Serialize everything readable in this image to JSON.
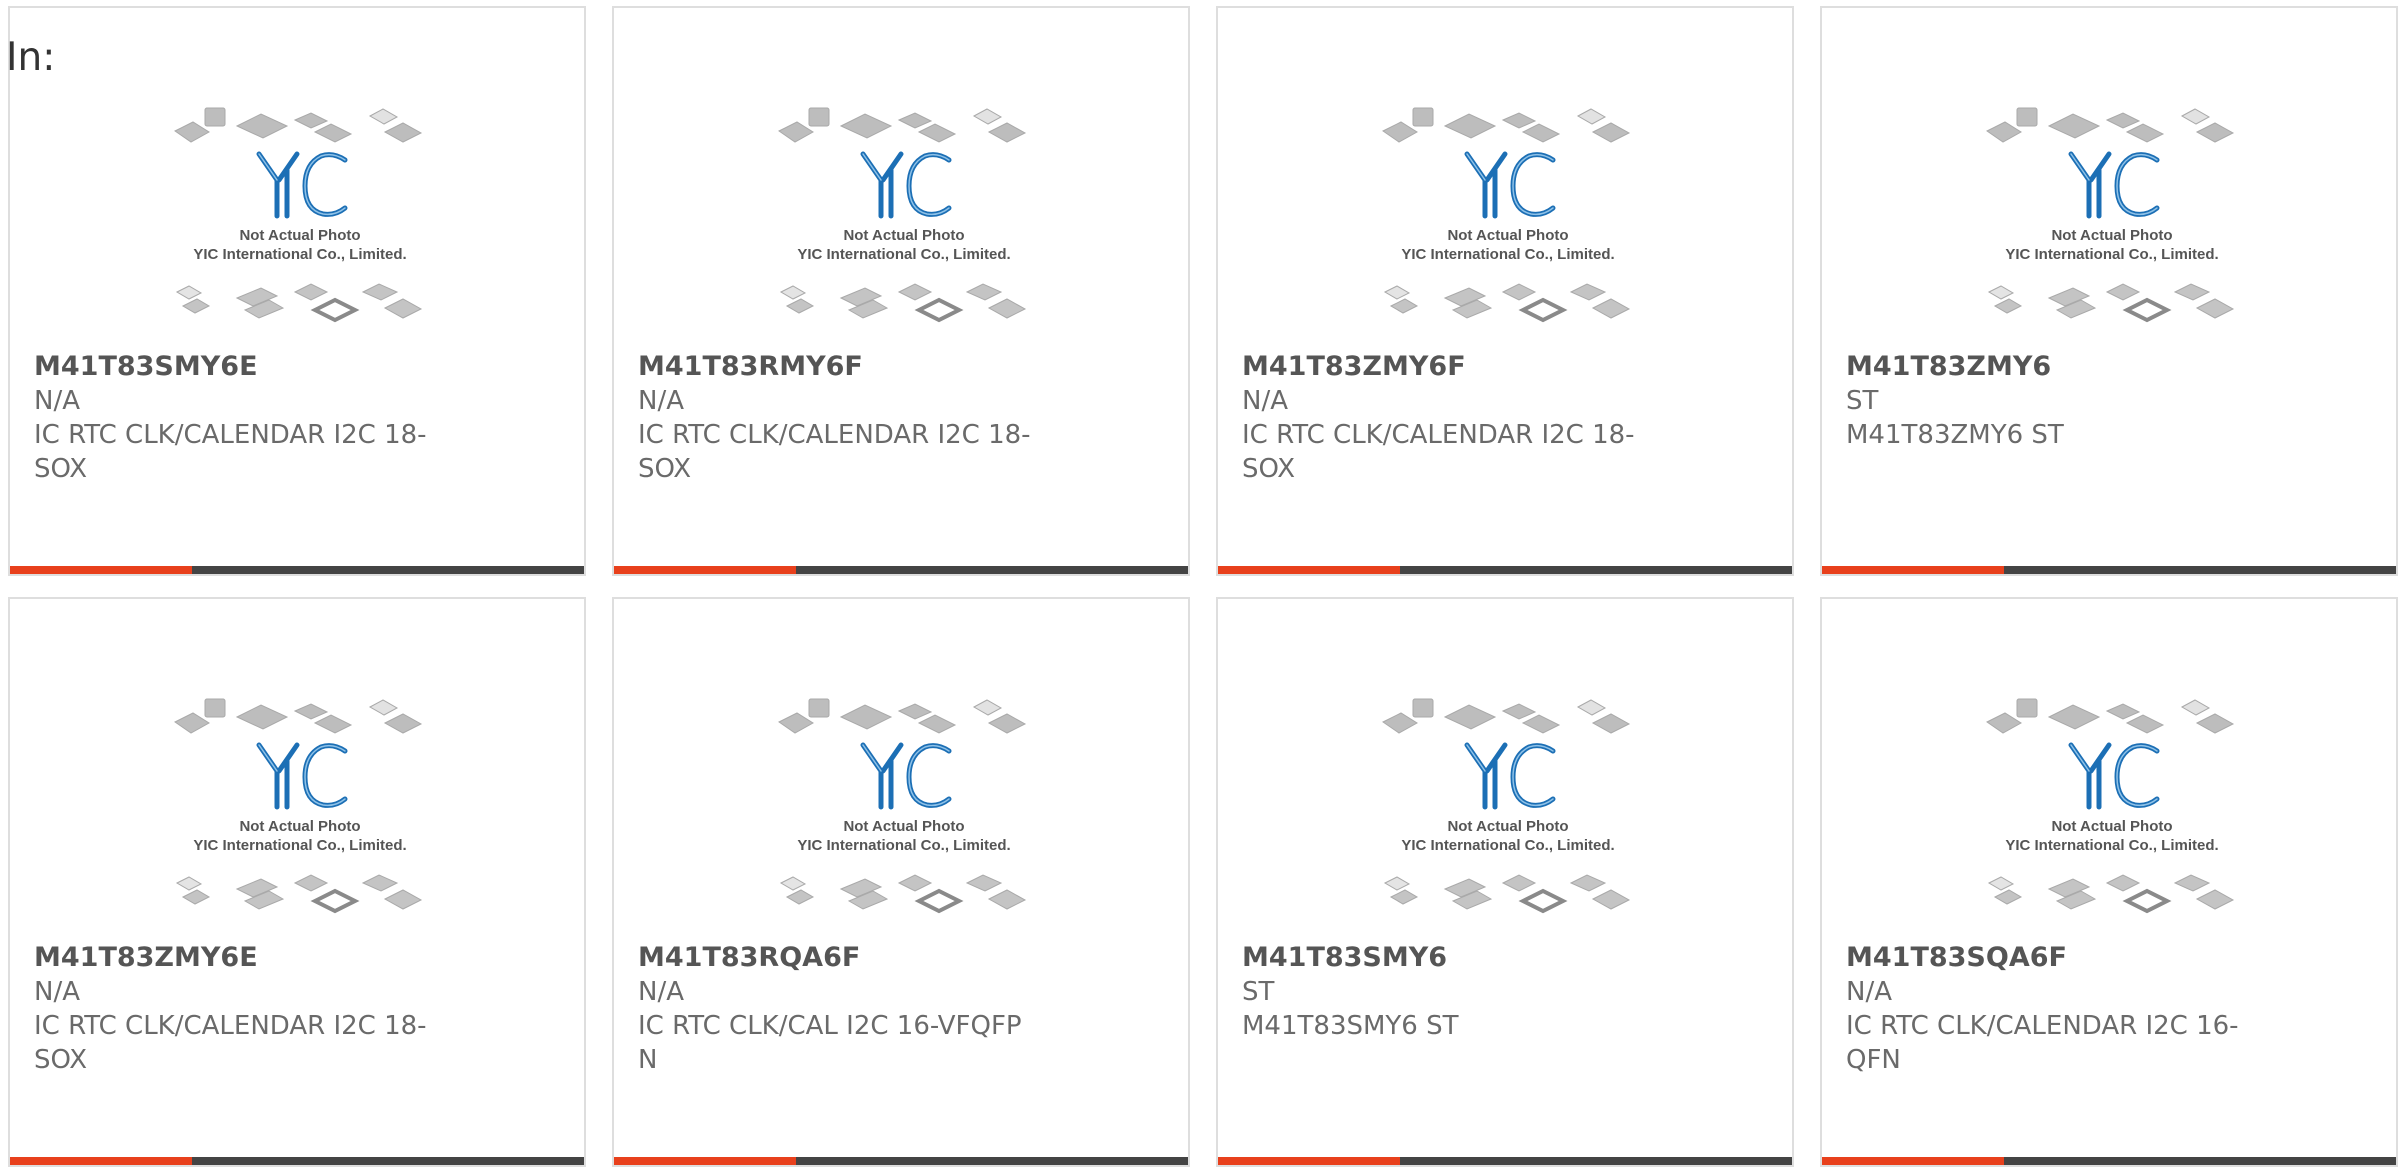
{
  "header": {
    "label": "In:"
  },
  "placeholder": {
    "line1": "Not Actual Photo",
    "line2": "YIC International Co., Limited.",
    "logo_text": "YIC"
  },
  "colors": {
    "accent": "#e8401c",
    "bar": "#444444",
    "logo": "#1c6fb5"
  },
  "cards": [
    {
      "part_number": "M41T83SMY6E",
      "manufacturer": "N/A",
      "description": "IC RTC CLK/CALENDAR I2C 18-SOX"
    },
    {
      "part_number": "M41T83RMY6F",
      "manufacturer": "N/A",
      "description": "IC RTC CLK/CALENDAR I2C 18-SOX"
    },
    {
      "part_number": "M41T83ZMY6F",
      "manufacturer": "N/A",
      "description": "IC RTC CLK/CALENDAR I2C 18-SOX"
    },
    {
      "part_number": "M41T83ZMY6",
      "manufacturer": "ST",
      "description": "M41T83ZMY6 ST"
    },
    {
      "part_number": "M41T83ZMY6E",
      "manufacturer": "N/A",
      "description": "IC RTC CLK/CALENDAR I2C 18-SOX"
    },
    {
      "part_number": "M41T83RQA6F",
      "manufacturer": "N/A",
      "description": "IC RTC CLK/CAL I2C 16-VFQFPN"
    },
    {
      "part_number": "M41T83SMY6",
      "manufacturer": "ST",
      "description": "M41T83SMY6 ST"
    },
    {
      "part_number": "M41T83SQA6F",
      "manufacturer": "N/A",
      "description": "IC RTC CLK/CALENDAR I2C 16-QFN"
    }
  ]
}
